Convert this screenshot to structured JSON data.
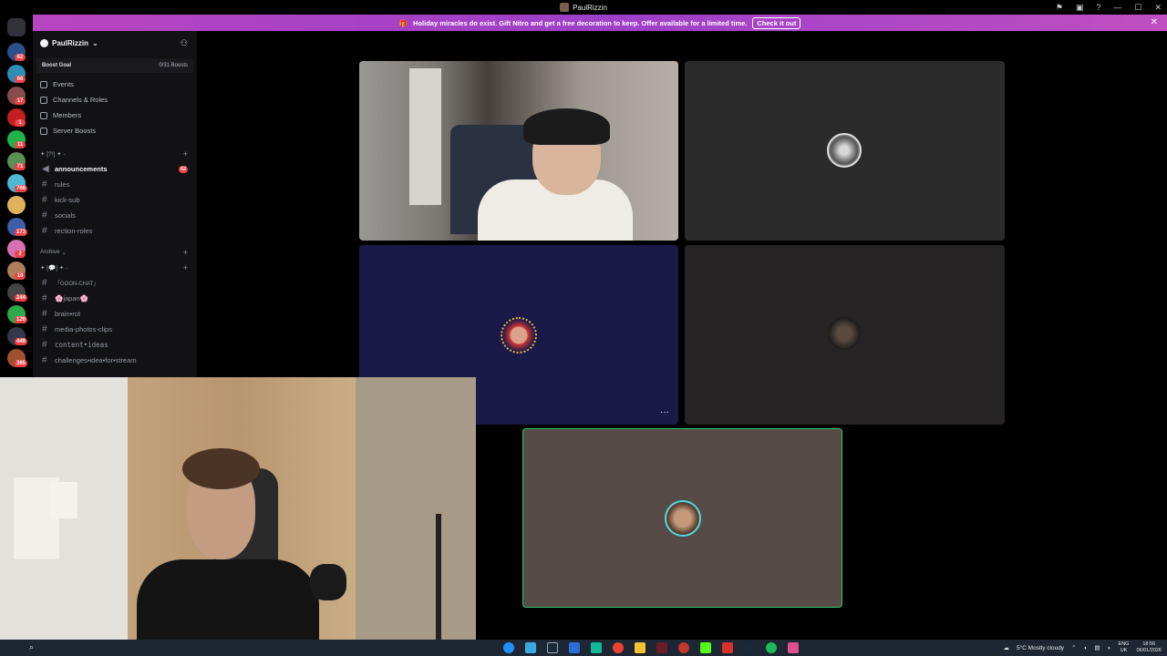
{
  "window": {
    "title": "PaulRizzin",
    "controls": [
      "—",
      "☐",
      "✕"
    ]
  },
  "banner": {
    "text": "Holiday miracles do exist. Gift Nitro and get a free decoration to keep. Offer available for a limited time.",
    "button": "Check it out",
    "close": "✕"
  },
  "rail_badges": [
    "62",
    "66",
    "17",
    "1",
    "11",
    "71",
    "766",
    "",
    "173",
    "2",
    "10",
    "244",
    "120",
    "449",
    "365"
  ],
  "sidebar": {
    "server_name": "PaulRizzin",
    "boost_goal_label": "Boost Goal",
    "boost_goal_value": "0/31 Boosts",
    "menu": [
      "Events",
      "Channels & Roles",
      "Members",
      "Server Boosts"
    ],
    "category1": "✦ [?!] ✦ -",
    "channels1": [
      {
        "name": "announcements",
        "badge": "62",
        "bold": true
      },
      {
        "name": "rules"
      },
      {
        "name": "kick-sub"
      },
      {
        "name": "socials"
      },
      {
        "name": "rection-roles"
      }
    ],
    "category2": "Archive",
    "category3": "✦ [💬] ✦ -",
    "channels2": [
      {
        "name": "「GOON-CHAT」"
      },
      {
        "name": "🌸japan🌸"
      },
      {
        "name": "brain•rot"
      },
      {
        "name": "media-photos-clips"
      },
      {
        "name": "content•ideas"
      },
      {
        "name": "challenges•idea•for•stream"
      }
    ]
  },
  "stage": {
    "more_button": "···"
  },
  "taskbar": {
    "weather": "5°C  Mostly cloudy",
    "lang_top": "ENG",
    "lang_bottom": "UK",
    "time": "18:56",
    "date": "06/01/2026"
  }
}
